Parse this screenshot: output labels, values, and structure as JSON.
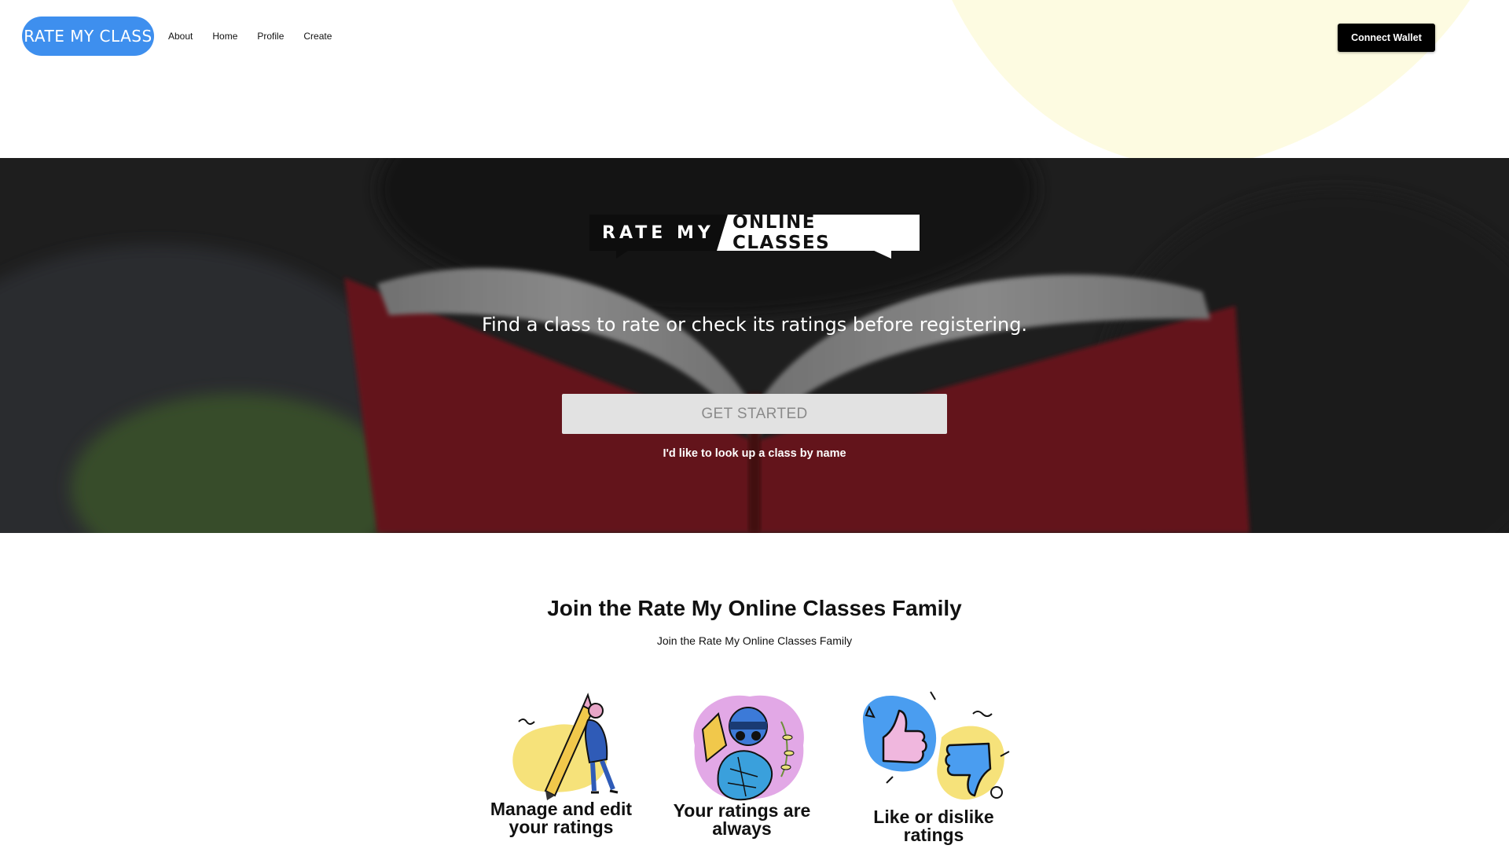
{
  "header": {
    "logo_text": "RATE MY CLASS",
    "nav": [
      "About",
      "Home",
      "Profile",
      "Create"
    ],
    "connect_label": "Connect Wallet"
  },
  "hero": {
    "brand_left": "RATE MY",
    "brand_right": "ONLINE CLASSES",
    "tagline": "Find a class to rate or check its ratings before registering.",
    "cta_label": "GET STARTED",
    "lookup_link": "I'd like to look up a class by name"
  },
  "join": {
    "title": "Join the Rate My Online Classes Family",
    "subtitle": "Join the Rate My Online Classes Family",
    "features": [
      {
        "label": "Manage and edit your ratings",
        "icon": "pencil-person-icon"
      },
      {
        "label": "Your ratings are always",
        "icon": "anonymous-person-icon"
      },
      {
        "label": "Like or dislike ratings",
        "icon": "thumbs-up-down-icon"
      }
    ]
  },
  "colors": {
    "logo_pill": "#3e8fee",
    "header_blob": "#fdfbe1",
    "cta_bg": "#e2e2e2",
    "hero_book": "#8a1f26"
  }
}
